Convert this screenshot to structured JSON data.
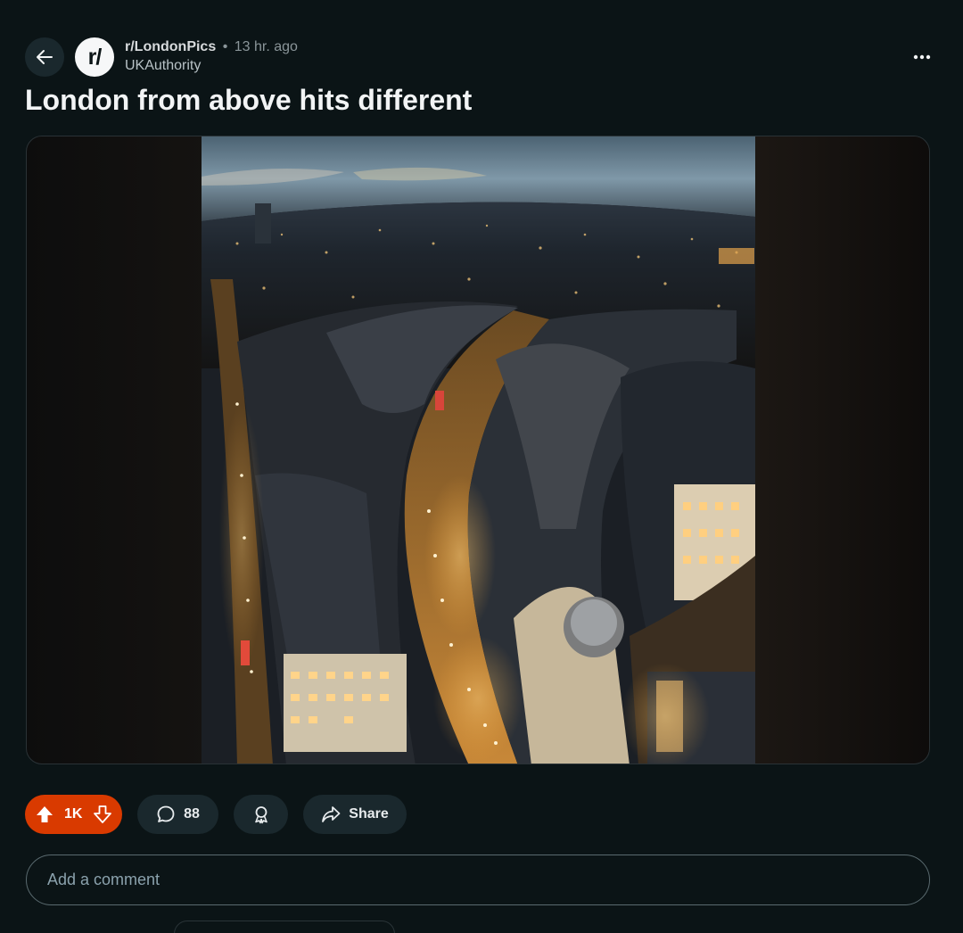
{
  "post": {
    "subreddit": "r/LondonPics",
    "subreddit_icon_text": "r/",
    "separator": "•",
    "time_ago": "13 hr. ago",
    "author": "UKAuthority",
    "title": "London from above hits different"
  },
  "icons": {
    "back": "arrow-left-icon",
    "more": "more-horizontal-icon",
    "upvote": "upvote-arrow-icon",
    "downvote": "downvote-arrow-icon",
    "comment": "speech-bubble-icon",
    "award": "award-ribbon-icon",
    "share": "share-arrow-icon"
  },
  "actions": {
    "vote_count": "1K",
    "comment_count": "88",
    "share_label": "Share"
  },
  "comment_input": {
    "placeholder": "Add a comment"
  },
  "colors": {
    "background": "#0b1416",
    "upvoted_accent": "#d93a00",
    "pill_background": "#1a282d"
  }
}
